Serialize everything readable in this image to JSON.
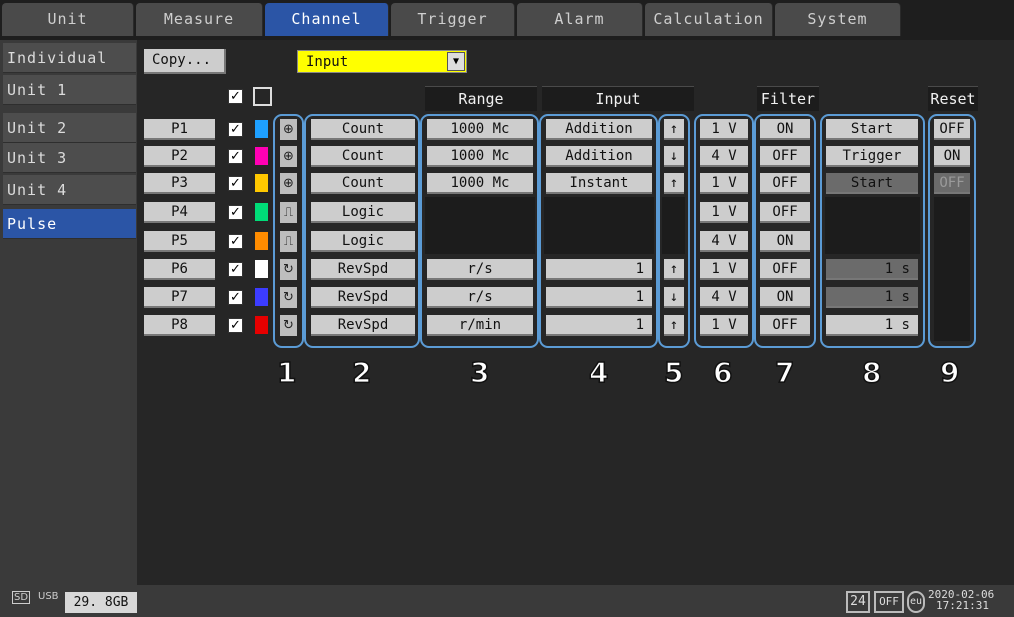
{
  "tabs": [
    "Unit",
    "Measure",
    "Channel",
    "Trigger",
    "Alarm",
    "Calculation",
    "System"
  ],
  "sidebar": [
    "Individual",
    "Unit 1",
    "Unit 2",
    "Unit 3",
    "Unit 4",
    "Pulse"
  ],
  "toolbar": {
    "copy_label": "Copy...",
    "select_value": "Input",
    "select_arrow": "▼"
  },
  "headers": {
    "range": "Range",
    "input": "Input",
    "filter": "Filter",
    "reset": "Reset"
  },
  "check_mark": "✓",
  "icons": {
    "count": "⊕",
    "logic": "⎍",
    "revspd": "↻"
  },
  "rows": [
    {
      "ch": "P1",
      "color": "#1ea0ff",
      "mode": "Count",
      "range": "1000 Mc",
      "input": "Addition",
      "slope": "↑",
      "level": "1 V",
      "filter": "ON",
      "start": "Start",
      "reset": "OFF"
    },
    {
      "ch": "P2",
      "color": "#ff00b4",
      "mode": "Count",
      "range": "1000 Mc",
      "input": "Addition",
      "slope": "↓",
      "level": "4 V",
      "filter": "OFF",
      "start": "Trigger",
      "reset": "ON"
    },
    {
      "ch": "P3",
      "color": "#ffc800",
      "mode": "Count",
      "range": "1000 Mc",
      "input": "Instant",
      "slope": "↑",
      "level": "1 V",
      "filter": "OFF",
      "start": "Start",
      "reset": "OFF"
    },
    {
      "ch": "P4",
      "color": "#00dc78",
      "mode": "Logic",
      "range": "",
      "input": "",
      "slope": "",
      "level": "1 V",
      "filter": "OFF",
      "start": "",
      "reset": ""
    },
    {
      "ch": "P5",
      "color": "#ff8c00",
      "mode": "Logic",
      "range": "",
      "input": "",
      "slope": "",
      "level": "4 V",
      "filter": "ON",
      "start": "",
      "reset": ""
    },
    {
      "ch": "P6",
      "color": "#ffffff",
      "mode": "RevSpd",
      "range": "r/s",
      "input": "1",
      "slope": "↑",
      "level": "1 V",
      "filter": "OFF",
      "start": "1 s",
      "reset": ""
    },
    {
      "ch": "P7",
      "color": "#3c3cff",
      "mode": "RevSpd",
      "range": "r/s",
      "input": "1",
      "slope": "↓",
      "level": "4 V",
      "filter": "ON",
      "start": "1 s",
      "reset": ""
    },
    {
      "ch": "P8",
      "color": "#e60000",
      "mode": "RevSpd",
      "range": "r/min",
      "input": "1",
      "slope": "↑",
      "level": "1 V",
      "filter": "OFF",
      "start": "1 s",
      "reset": ""
    }
  ],
  "callouts": [
    "1",
    "2",
    "3",
    "4",
    "5",
    "6",
    "7",
    "8",
    "9"
  ],
  "status": {
    "sd": "SD",
    "usb": "USB",
    "storage": "29. 8GB",
    "num24": "24",
    "off": "OFF",
    "eu": "eu",
    "date": "2020-02-06",
    "time": "17:21:31"
  }
}
